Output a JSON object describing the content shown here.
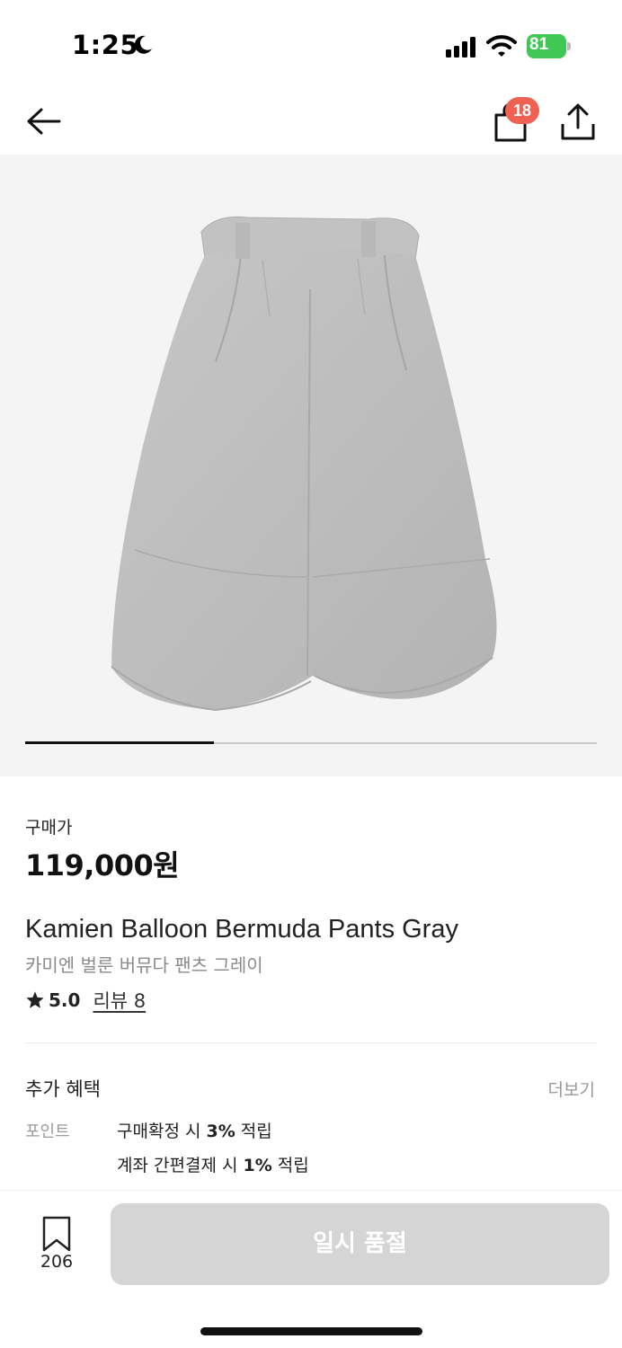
{
  "status_bar": {
    "time": "1:25",
    "battery": "81"
  },
  "nav": {
    "cart_count": "18"
  },
  "gallery": {
    "progress": 0.33
  },
  "product": {
    "price_label": "구매가",
    "price": "119,000원",
    "name_en": "Kamien Balloon Bermuda Pants Gray",
    "name_ko": "카미엔 벌룬 버뮤다 팬츠 그레이",
    "rating": "5.0",
    "review_link": "리뷰 8"
  },
  "benefits": {
    "title": "추가 혜택",
    "more": "더보기",
    "point_label": "포인트",
    "line1_prefix": "구매확정 시 ",
    "line1_value": "3%",
    "line1_suffix": " 적립",
    "line2_prefix": "계좌 간편결제 시 ",
    "line2_value": "1%",
    "line2_suffix": " 적립"
  },
  "bottom": {
    "bookmark_count": "206",
    "soldout_label": "일시 품절"
  },
  "colors": {
    "badge": "#ef6253",
    "battery": "#3fc853",
    "soldout_button": "#d5d5d5",
    "gallery_bg": "#f4f4f4"
  },
  "icons": [
    "moon-icon",
    "signal-icon",
    "wifi-icon",
    "battery-icon",
    "back-arrow-icon",
    "shopping-bag-icon",
    "share-icon",
    "star-icon",
    "bookmark-icon"
  ]
}
